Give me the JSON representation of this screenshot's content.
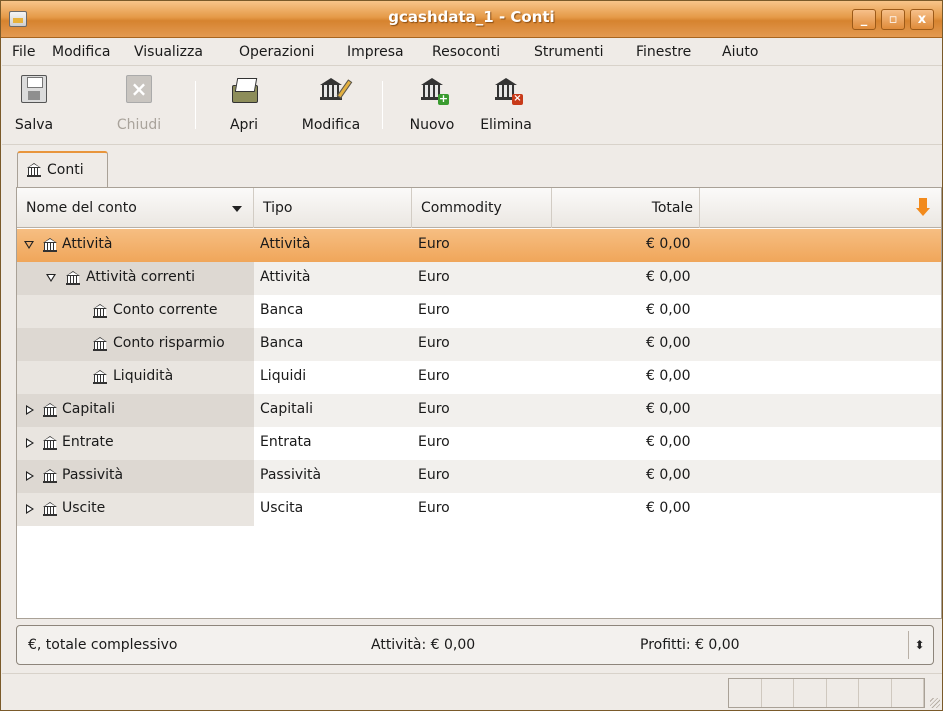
{
  "window": {
    "title": "gcashdata_1 - Conti",
    "controls": {
      "minimize": "_",
      "maximize": "▫",
      "close": "x"
    }
  },
  "menubar": {
    "items": [
      "File",
      "Modifica",
      "Visualizza",
      "Operazioni",
      "Impresa",
      "Resoconti",
      "Strumenti",
      "Finestre",
      "Aiuto"
    ]
  },
  "toolbar": {
    "save": "Salva",
    "close": "Chiudi",
    "open": "Apri",
    "edit": "Modifica",
    "new": "Nuovo",
    "delete": "Elimina"
  },
  "tabs": [
    {
      "label": "Conti",
      "icon": "bank-icon"
    }
  ],
  "tree": {
    "columns": [
      "Nome del conto",
      "Tipo",
      "Commodity",
      "Totale"
    ],
    "rows": [
      {
        "name": "Attività",
        "type": "Attività",
        "commodity": "Euro",
        "total": "€ 0,00",
        "level": 0,
        "expander": "open"
      },
      {
        "name": "Attività correnti",
        "type": "Attività",
        "commodity": "Euro",
        "total": "€ 0,00",
        "level": 1,
        "expander": "open"
      },
      {
        "name": "Conto corrente",
        "type": "Banca",
        "commodity": "Euro",
        "total": "€ 0,00",
        "level": 2,
        "expander": "none"
      },
      {
        "name": "Conto risparmio",
        "type": "Banca",
        "commodity": "Euro",
        "total": "€ 0,00",
        "level": 2,
        "expander": "none"
      },
      {
        "name": "Liquidità",
        "type": "Liquidi",
        "commodity": "Euro",
        "total": "€ 0,00",
        "level": 2,
        "expander": "none"
      },
      {
        "name": "Capitali",
        "type": "Capitali",
        "commodity": "Euro",
        "total": "€ 0,00",
        "level": 0,
        "expander": "closed"
      },
      {
        "name": "Entrate",
        "type": "Entrata",
        "commodity": "Euro",
        "total": "€ 0,00",
        "level": 0,
        "expander": "closed"
      },
      {
        "name": "Passività",
        "type": "Passività",
        "commodity": "Euro",
        "total": "€ 0,00",
        "level": 0,
        "expander": "closed"
      },
      {
        "name": "Uscite",
        "type": "Uscita",
        "commodity": "Euro",
        "total": "€ 0,00",
        "level": 0,
        "expander": "closed"
      }
    ],
    "selected_index": 0
  },
  "summary": {
    "label": "€, totale complessivo",
    "assets": "Attività: € 0,00",
    "profits": "Profitti: € 0,00",
    "spin": "⬍"
  },
  "colors": {
    "titlebar": "#e59a48",
    "selection": "#f0a65a",
    "tab_accent": "#e8953c"
  }
}
